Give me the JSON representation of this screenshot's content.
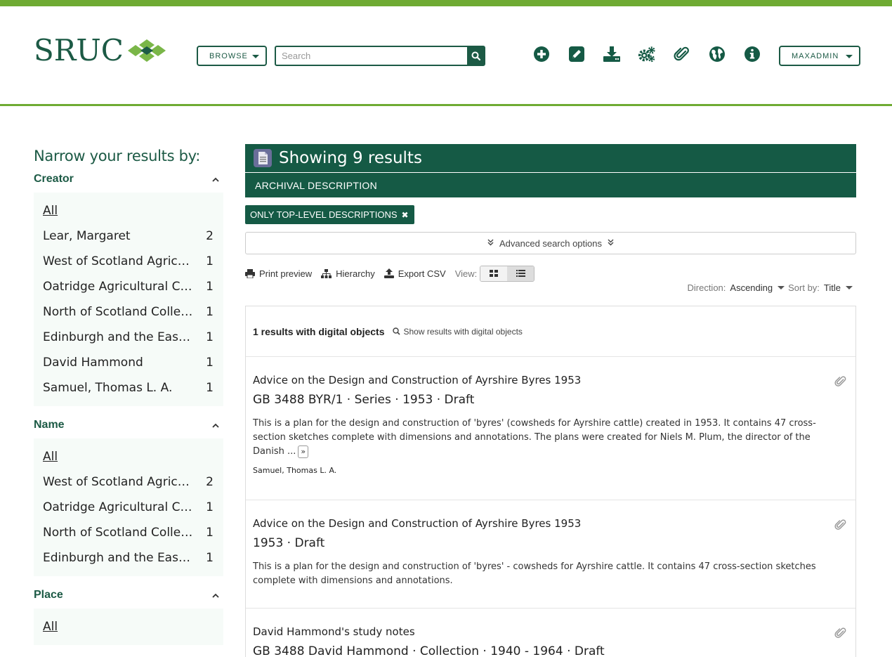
{
  "header": {
    "logo_text": "SRUC",
    "browse_label": "BROWSE",
    "search_placeholder": "Search",
    "user_label": "MAXADMIN",
    "colors": {
      "accent_green": "#6fab33",
      "dark_green": "#155a45"
    },
    "tool_icons": [
      "add-icon",
      "edit-icon",
      "import-icon",
      "manage-icon",
      "clipboard-icon",
      "language-icon",
      "info-icon"
    ]
  },
  "sidebar": {
    "title": "Narrow your results by:",
    "facets": [
      {
        "name": "Creator",
        "items": [
          {
            "label": "All",
            "count": ""
          },
          {
            "label": "Lear, Margaret",
            "count": "2"
          },
          {
            "label": "West of Scotland Agricultural College",
            "count": "1"
          },
          {
            "label": "Oatridge Agricultural College",
            "count": "1"
          },
          {
            "label": "North of Scotland College of Agriculture",
            "count": "1"
          },
          {
            "label": "Edinburgh and the East of Scotland College of Agriculture",
            "count": "1"
          },
          {
            "label": "David Hammond",
            "count": "1"
          },
          {
            "label": "Samuel, Thomas L. A.",
            "count": "1"
          }
        ]
      },
      {
        "name": "Name",
        "items": [
          {
            "label": "All",
            "count": ""
          },
          {
            "label": "West of Scotland Agricultural College",
            "count": "2"
          },
          {
            "label": "Oatridge Agricultural College",
            "count": "1"
          },
          {
            "label": "North of Scotland College of Agriculture",
            "count": "1"
          },
          {
            "label": "Edinburgh and the East of Scotland College of Agriculture",
            "count": "1"
          }
        ]
      },
      {
        "name": "Place",
        "items": [
          {
            "label": "All",
            "count": ""
          }
        ]
      }
    ]
  },
  "main": {
    "results_title": "Showing 9 results",
    "section_label": "ARCHIVAL DESCRIPTION",
    "filter_tag": "ONLY TOP-LEVEL DESCRIPTIONS",
    "advanced_search": "Advanced search options",
    "actions": {
      "print": "Print preview",
      "hierarchy": "Hierarchy",
      "export": "Export CSV",
      "view": "View:"
    },
    "sort": {
      "direction_label": "Direction:",
      "direction_value": "Ascending",
      "sort_label": "Sort by:",
      "sort_value": "Title"
    },
    "digital": {
      "count_text": "1 results with digital objects",
      "show_link": "Show results with digital objects"
    },
    "results": [
      {
        "title": "Advice on the Design and Construction of Ayrshire Byres 1953",
        "meta": "GB 3488 BYR/1 · Series · 1953 · Draft",
        "description": "This is a plan for the design and construction of 'byres' (cowsheds for Ayrshire cattle) created in 1953. It contains 47 cross-section sketches complete with dimensions and annotations. The plans were created for Niels M. Plum, the director of the Danish ...",
        "more": "»",
        "creator": "Samuel, Thomas L. A."
      },
      {
        "title": "Advice on the Design and Construction of Ayrshire Byres 1953",
        "meta": "1953 · Draft",
        "description": "This is a plan for the design and construction of 'byres' - cowsheds for Ayrshire cattle. It contains 47 cross-section sketches complete with dimensions and annotations.",
        "more": "",
        "creator": ""
      },
      {
        "title": "David Hammond's study notes",
        "meta": "GB 3488 David Hammond · Collection · 1940 - 1964 · Draft",
        "description": "",
        "more": "",
        "creator": ""
      }
    ]
  }
}
